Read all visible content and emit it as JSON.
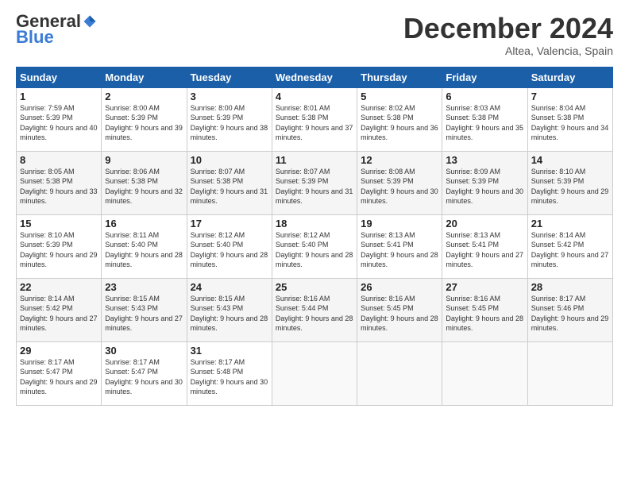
{
  "header": {
    "logo_general": "General",
    "logo_blue": "Blue",
    "month_title": "December 2024",
    "subtitle": "Altea, Valencia, Spain"
  },
  "weekdays": [
    "Sunday",
    "Monday",
    "Tuesday",
    "Wednesday",
    "Thursday",
    "Friday",
    "Saturday"
  ],
  "weeks": [
    [
      {
        "day": "1",
        "sunrise": "7:59 AM",
        "sunset": "5:39 PM",
        "daylight": "9 hours and 40 minutes."
      },
      {
        "day": "2",
        "sunrise": "8:00 AM",
        "sunset": "5:39 PM",
        "daylight": "9 hours and 39 minutes."
      },
      {
        "day": "3",
        "sunrise": "8:00 AM",
        "sunset": "5:39 PM",
        "daylight": "9 hours and 38 minutes."
      },
      {
        "day": "4",
        "sunrise": "8:01 AM",
        "sunset": "5:38 PM",
        "daylight": "9 hours and 37 minutes."
      },
      {
        "day": "5",
        "sunrise": "8:02 AM",
        "sunset": "5:38 PM",
        "daylight": "9 hours and 36 minutes."
      },
      {
        "day": "6",
        "sunrise": "8:03 AM",
        "sunset": "5:38 PM",
        "daylight": "9 hours and 35 minutes."
      },
      {
        "day": "7",
        "sunrise": "8:04 AM",
        "sunset": "5:38 PM",
        "daylight": "9 hours and 34 minutes."
      }
    ],
    [
      {
        "day": "8",
        "sunrise": "8:05 AM",
        "sunset": "5:38 PM",
        "daylight": "9 hours and 33 minutes."
      },
      {
        "day": "9",
        "sunrise": "8:06 AM",
        "sunset": "5:38 PM",
        "daylight": "9 hours and 32 minutes."
      },
      {
        "day": "10",
        "sunrise": "8:07 AM",
        "sunset": "5:38 PM",
        "daylight": "9 hours and 31 minutes."
      },
      {
        "day": "11",
        "sunrise": "8:07 AM",
        "sunset": "5:39 PM",
        "daylight": "9 hours and 31 minutes."
      },
      {
        "day": "12",
        "sunrise": "8:08 AM",
        "sunset": "5:39 PM",
        "daylight": "9 hours and 30 minutes."
      },
      {
        "day": "13",
        "sunrise": "8:09 AM",
        "sunset": "5:39 PM",
        "daylight": "9 hours and 30 minutes."
      },
      {
        "day": "14",
        "sunrise": "8:10 AM",
        "sunset": "5:39 PM",
        "daylight": "9 hours and 29 minutes."
      }
    ],
    [
      {
        "day": "15",
        "sunrise": "8:10 AM",
        "sunset": "5:39 PM",
        "daylight": "9 hours and 29 minutes."
      },
      {
        "day": "16",
        "sunrise": "8:11 AM",
        "sunset": "5:40 PM",
        "daylight": "9 hours and 28 minutes."
      },
      {
        "day": "17",
        "sunrise": "8:12 AM",
        "sunset": "5:40 PM",
        "daylight": "9 hours and 28 minutes."
      },
      {
        "day": "18",
        "sunrise": "8:12 AM",
        "sunset": "5:40 PM",
        "daylight": "9 hours and 28 minutes."
      },
      {
        "day": "19",
        "sunrise": "8:13 AM",
        "sunset": "5:41 PM",
        "daylight": "9 hours and 28 minutes."
      },
      {
        "day": "20",
        "sunrise": "8:13 AM",
        "sunset": "5:41 PM",
        "daylight": "9 hours and 27 minutes."
      },
      {
        "day": "21",
        "sunrise": "8:14 AM",
        "sunset": "5:42 PM",
        "daylight": "9 hours and 27 minutes."
      }
    ],
    [
      {
        "day": "22",
        "sunrise": "8:14 AM",
        "sunset": "5:42 PM",
        "daylight": "9 hours and 27 minutes."
      },
      {
        "day": "23",
        "sunrise": "8:15 AM",
        "sunset": "5:43 PM",
        "daylight": "9 hours and 27 minutes."
      },
      {
        "day": "24",
        "sunrise": "8:15 AM",
        "sunset": "5:43 PM",
        "daylight": "9 hours and 28 minutes."
      },
      {
        "day": "25",
        "sunrise": "8:16 AM",
        "sunset": "5:44 PM",
        "daylight": "9 hours and 28 minutes."
      },
      {
        "day": "26",
        "sunrise": "8:16 AM",
        "sunset": "5:45 PM",
        "daylight": "9 hours and 28 minutes."
      },
      {
        "day": "27",
        "sunrise": "8:16 AM",
        "sunset": "5:45 PM",
        "daylight": "9 hours and 28 minutes."
      },
      {
        "day": "28",
        "sunrise": "8:17 AM",
        "sunset": "5:46 PM",
        "daylight": "9 hours and 29 minutes."
      }
    ],
    [
      {
        "day": "29",
        "sunrise": "8:17 AM",
        "sunset": "5:47 PM",
        "daylight": "9 hours and 29 minutes."
      },
      {
        "day": "30",
        "sunrise": "8:17 AM",
        "sunset": "5:47 PM",
        "daylight": "9 hours and 30 minutes."
      },
      {
        "day": "31",
        "sunrise": "8:17 AM",
        "sunset": "5:48 PM",
        "daylight": "9 hours and 30 minutes."
      },
      null,
      null,
      null,
      null
    ]
  ]
}
